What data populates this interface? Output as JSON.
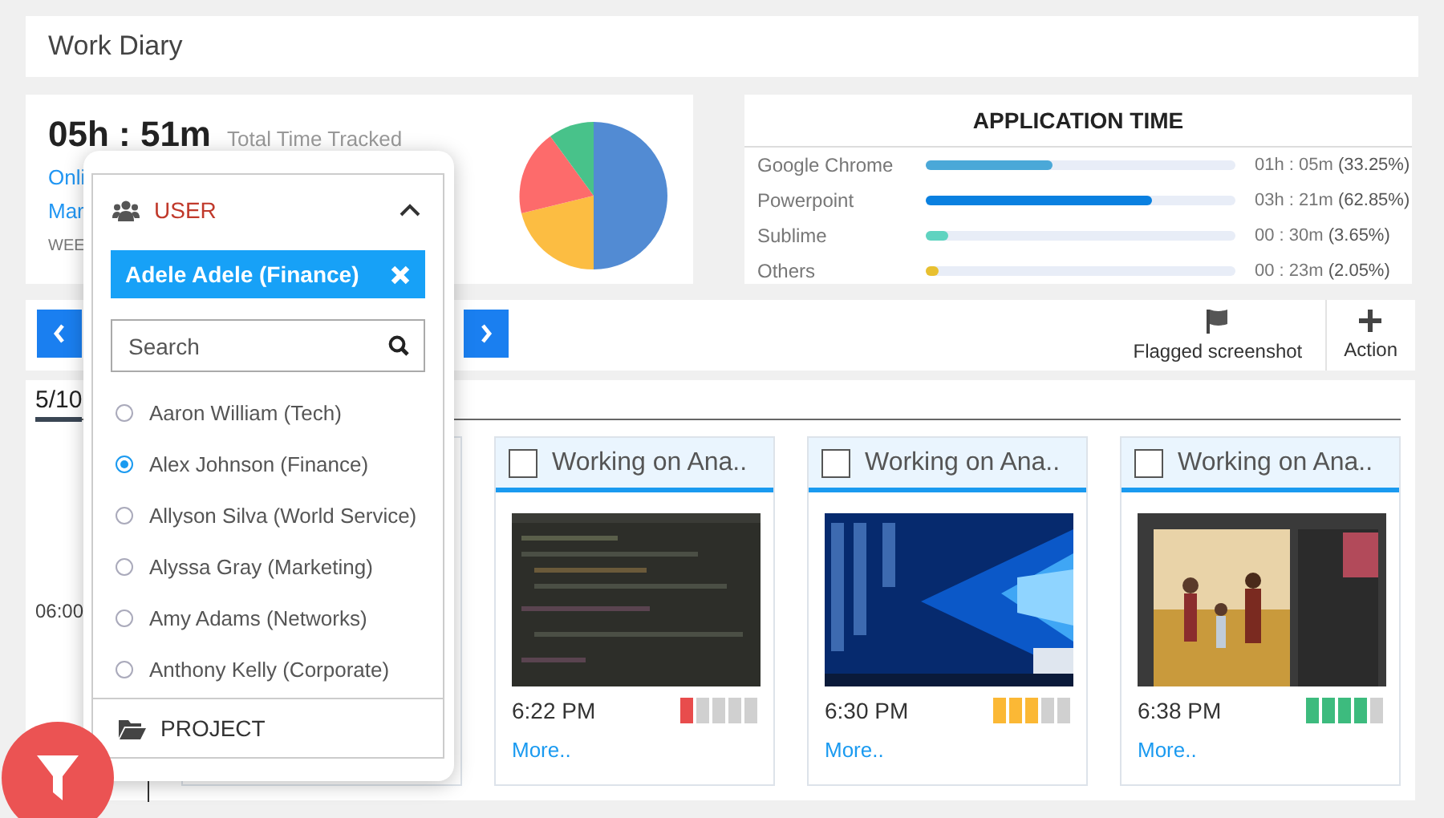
{
  "window": {
    "title": "Work Diary"
  },
  "summary": {
    "total": "05h : 51m",
    "total_label": "Total Time Tracked",
    "links": [
      "Onli",
      "Mar"
    ],
    "week": "WEE"
  },
  "application_time": {
    "title": "APPLICATION TIME",
    "apps": [
      {
        "name": "Google Chrome",
        "level": 0.41,
        "color": "#4aa8d8",
        "reading": "01h : 05m **(33.25%)**"
      },
      {
        "name": "Powerpoint",
        "level": 0.73,
        "color": "#0a80e0",
        "reading": "03h : 21m **(62.85%)**"
      },
      {
        "name": "Sublime",
        "level": 0.07,
        "color": "#5fd3c0",
        "reading": "00 : 30m **(3.65%)**"
      },
      {
        "name": "Others",
        "level": 0.04,
        "color": "#e8c030",
        "reading": "00 : 23m **(2.05%)**"
      }
    ]
  },
  "toolbar": {
    "flagged": "Flagged screenshot",
    "action": "Action"
  },
  "timeline": {
    "date": "5/10",
    "time": "06:00"
  },
  "cards": [
    {
      "title": "Working on Ana..",
      "checked": false,
      "time": "6:22 PM",
      "activity": {
        "level": 0.2,
        "color": "#e84c4c"
      },
      "more": "More.."
    },
    {
      "title": "Working on Ana..",
      "checked": false,
      "time": "6:30 PM",
      "activity": {
        "level": 0.6,
        "color": "#fbb835"
      },
      "more": "More.."
    },
    {
      "title": "Working on Ana..",
      "checked": false,
      "time": "6:38 PM",
      "activity": {
        "level": 0.8,
        "color": "#3dbb7e"
      },
      "more": "More.."
    }
  ],
  "filter": {
    "user": {
      "label": "USER",
      "expanded": true,
      "chip": "Adele Adele (Finance)",
      "search": {
        "placeholder": "Search"
      },
      "options": [
        {
          "label": "Aaron William (Tech)",
          "selected": false
        },
        {
          "label": "Alex Johnson (Finance)",
          "selected": true
        },
        {
          "label": "Allyson Silva (World Service)",
          "selected": false
        },
        {
          "label": "Alyssa Gray (Marketing)",
          "selected": false
        },
        {
          "label": "Amy Adams (Networks)",
          "selected": false
        },
        {
          "label": "Anthony Kelly (Corporate)",
          "selected": false
        }
      ]
    },
    "project": {
      "label": "PROJECT"
    }
  }
}
